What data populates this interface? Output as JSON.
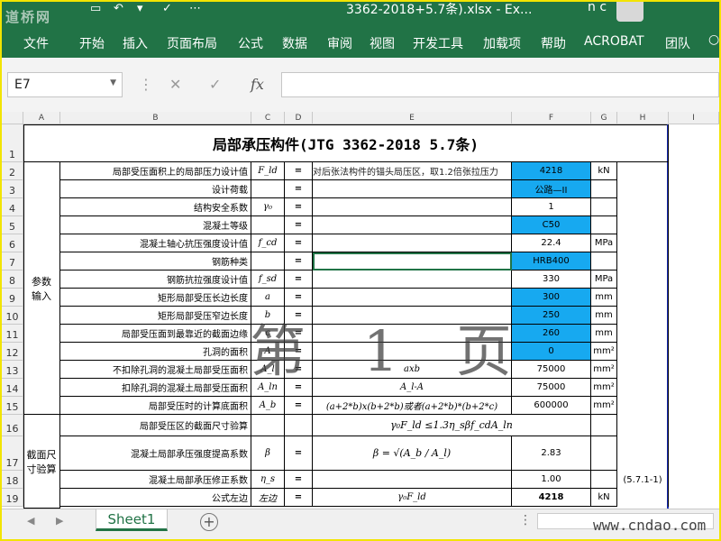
{
  "titlebar": {
    "logo": "道桥网",
    "filename": "3362-2018+5.7条).xlsx - Ex...",
    "user": "n c"
  },
  "ribbon": {
    "tabs": [
      "文件",
      "开始",
      "插入",
      "页面布局",
      "公式",
      "数据",
      "审阅",
      "视图",
      "开发工具",
      "加载项",
      "帮助",
      "ACROBAT",
      "团队"
    ]
  },
  "formula_bar": {
    "name_box": "E7",
    "value": ""
  },
  "sheet": {
    "columns": [
      "A",
      "B",
      "C",
      "D",
      "E",
      "F",
      "G",
      "H",
      "I"
    ],
    "rows": [
      "1",
      "2",
      "3",
      "4",
      "5",
      "6",
      "7",
      "8",
      "9",
      "10",
      "11",
      "12",
      "13",
      "14",
      "15",
      "16",
      "17",
      "18",
      "19"
    ],
    "title": "局部承压构件(JTG 3362-2018 5.7条)",
    "group_labels": {
      "params": "参数\n输入",
      "check": "截面尺\n寸验算"
    },
    "cells": {
      "r2": {
        "b": "局部受压面积上的局部压力设计值",
        "c": "F_ld",
        "d": "=",
        "e": "对后张法构件的锚头局压区，取1.2倍张拉压力",
        "f": "4218",
        "g": "kN"
      },
      "r3": {
        "b": "设计荷载",
        "d": "=",
        "f": "公路—II"
      },
      "r4": {
        "b": "结构安全系数",
        "c": "γ₀",
        "d": "=",
        "f": "1"
      },
      "r5": {
        "b": "混凝土等级",
        "d": "=",
        "f": "C50"
      },
      "r6": {
        "b": "混凝土轴心抗压强度设计值",
        "c": "f_cd",
        "d": "=",
        "f": "22.4",
        "g": "MPa"
      },
      "r7": {
        "b": "钢筋种类",
        "d": "=",
        "f": "HRB400"
      },
      "r8": {
        "b": "钢筋抗拉强度设计值",
        "c": "f_sd",
        "d": "=",
        "f": "330",
        "g": "MPa"
      },
      "r9": {
        "b": "矩形局部受压长边长度",
        "c": "a",
        "d": "=",
        "f": "300",
        "g": "mm"
      },
      "r10": {
        "b": "矩形局部受压窄边长度",
        "c": "b",
        "d": "=",
        "f": "250",
        "g": "mm"
      },
      "r11": {
        "b": "局部受压面到最靠近的截面边缘",
        "c": "c",
        "d": "=",
        "f": "260",
        "g": "mm"
      },
      "r12": {
        "b": "孔洞的面积",
        "c": "A",
        "d": "=",
        "f": "0",
        "g": "mm²"
      },
      "r13": {
        "b": "不扣除孔洞的混凝土局部受压面积",
        "c": "A_l",
        "d": "=",
        "e": "axb",
        "f": "75000",
        "g": "mm²"
      },
      "r14": {
        "b": "扣除孔洞的混凝土局部受压面积",
        "c": "A_ln",
        "d": "=",
        "e": "A_l-A",
        "f": "75000",
        "g": "mm²"
      },
      "r15": {
        "b": "局部受压时的计算底面积",
        "c": "A_b",
        "d": "=",
        "e": "(a+2*b)x(b+2*b)或者(a+2*b)*(b+2*c)",
        "f": "600000",
        "g": "mm²"
      },
      "r16": {
        "b": "局部受压区的截面尺寸验算",
        "e": "γ₀F_ld ≤1.3η_sβf_cdA_ln"
      },
      "r17": {
        "b": "混凝土局部承压强度提高系数",
        "c": "β",
        "d": "=",
        "e": "β = √(A_b / A_l)",
        "f": "2.83"
      },
      "r18": {
        "b": "混凝土局部承压修正系数",
        "c": "η_s",
        "d": "=",
        "f": "1.00",
        "h": "(5.7.1-1)"
      },
      "r19": {
        "b": "公式左边",
        "c": "左边",
        "d": "=",
        "e": "γ₀F_ld",
        "f": "4218",
        "g": "kN"
      }
    }
  },
  "watermark": "第 1 页",
  "sheet_tabs": {
    "active": "Sheet1"
  },
  "footer_site": "www.cndao.com"
}
